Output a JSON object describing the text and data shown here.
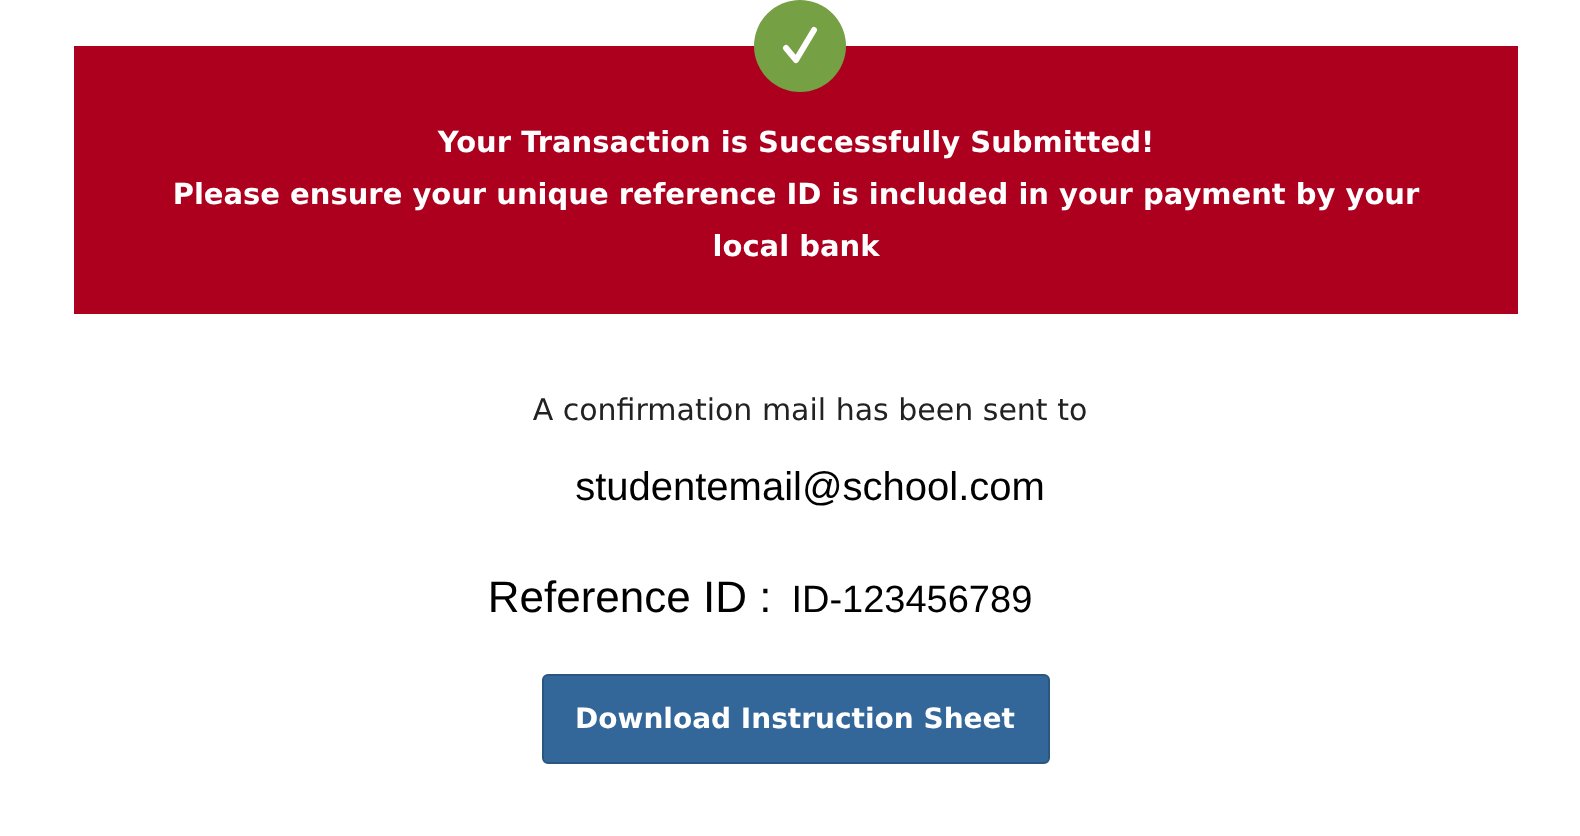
{
  "banner": {
    "title": "Your Transaction is Successfully Submitted!",
    "message": "Please ensure your unique reference ID is included in your payment by your local bank"
  },
  "confirmation": {
    "text": "A confirmation mail has been sent to",
    "email": "studentemail@school.com"
  },
  "reference": {
    "label": "Reference ID :",
    "value": "ID-123456789"
  },
  "button": {
    "label": "Download Instruction Sheet"
  }
}
